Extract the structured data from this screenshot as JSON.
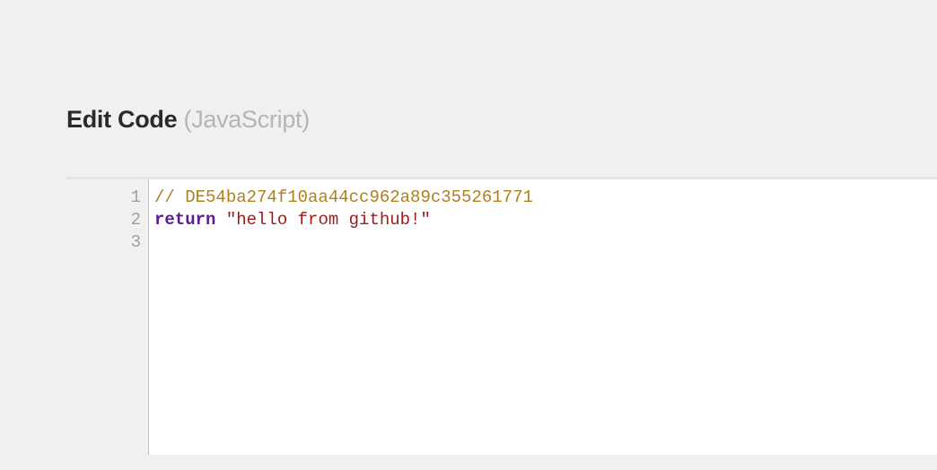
{
  "header": {
    "title": "Edit Code",
    "language": "(JavaScript)"
  },
  "editor": {
    "gutter": [
      "1",
      "2",
      "3"
    ],
    "lines": [
      {
        "tokens": [
          {
            "cls": "tok-comment",
            "text": "// DE54ba274f10aa44cc962a89c355261771"
          }
        ]
      },
      {
        "tokens": [
          {
            "cls": "tok-keyword",
            "text": "return"
          },
          {
            "cls": "",
            "text": " "
          },
          {
            "cls": "tok-string",
            "text": "\"hello from github!\""
          }
        ]
      },
      {
        "tokens": []
      }
    ]
  }
}
